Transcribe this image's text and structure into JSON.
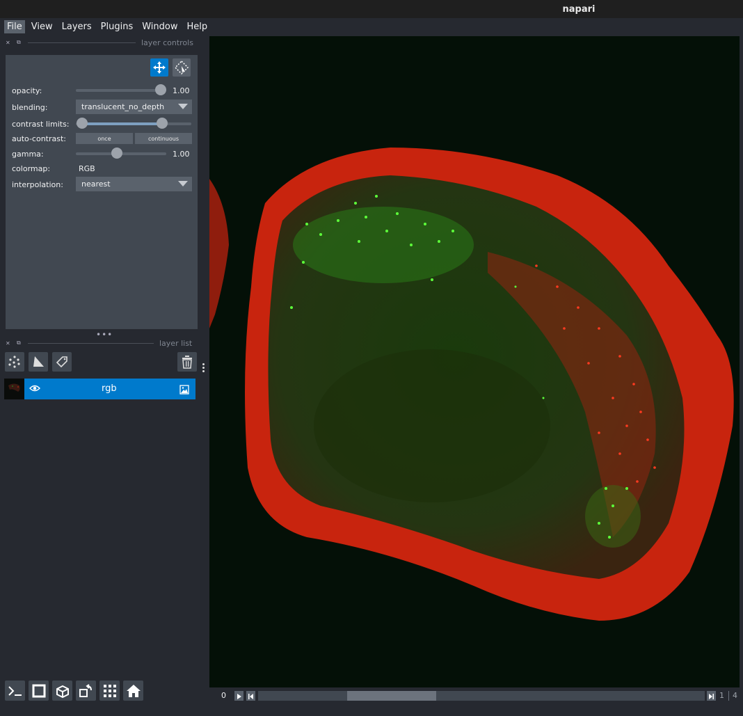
{
  "window": {
    "title": "napari"
  },
  "menu": {
    "items": [
      {
        "label": "File"
      },
      {
        "label": "View"
      },
      {
        "label": "Layers"
      },
      {
        "label": "Plugins"
      },
      {
        "label": "Window"
      },
      {
        "label": "Help"
      }
    ]
  },
  "layer_controls": {
    "header": "layer controls",
    "opacity": {
      "label": "opacity:",
      "value": "1.00",
      "level": 1.0
    },
    "blending": {
      "label": "blending:",
      "value": "translucent_no_depth"
    },
    "contrast_limits": {
      "label": "contrast limits:"
    },
    "auto_contrast": {
      "label": "auto-contrast:",
      "once": "once",
      "continuous": "continuous"
    },
    "gamma": {
      "label": "gamma:",
      "value": "1.00"
    },
    "colormap": {
      "label": "colormap:",
      "value": "RGB"
    },
    "interpolation": {
      "label": "interpolation:",
      "value": "nearest"
    }
  },
  "layer_list": {
    "header": "layer list",
    "layers": [
      {
        "name": "rgb",
        "visible": true,
        "type": "image"
      }
    ]
  },
  "dims": {
    "current_index": "0",
    "current": "1",
    "total": "4"
  },
  "colors": {
    "accent": "#007acc",
    "panel": "#414851",
    "background": "#262930"
  }
}
